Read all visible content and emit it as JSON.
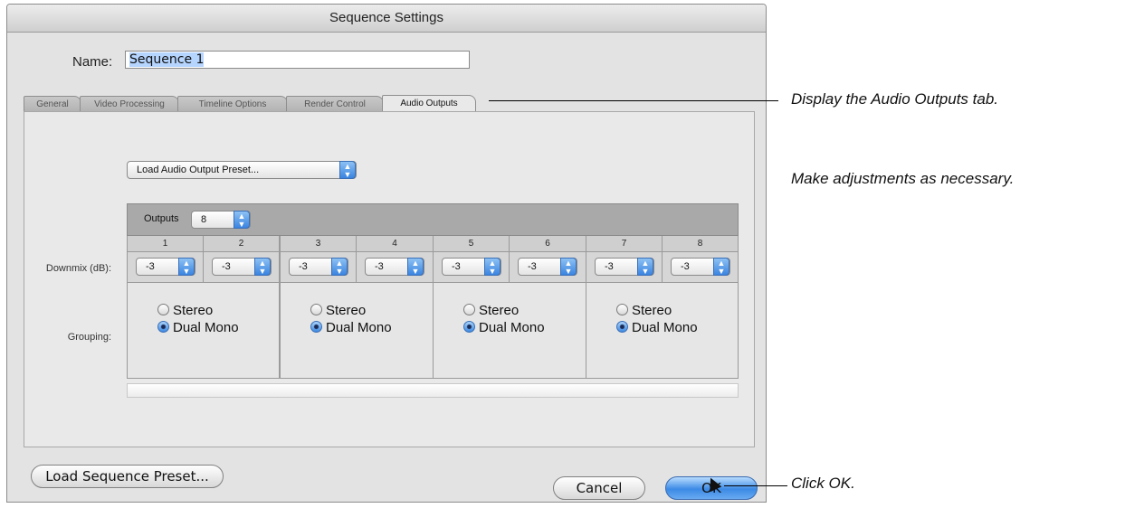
{
  "dialog": {
    "title": "Sequence Settings",
    "name_label": "Name:",
    "name_value": "Sequence 1"
  },
  "tabs": [
    {
      "label": "General"
    },
    {
      "label": "Video Processing"
    },
    {
      "label": "Timeline Options"
    },
    {
      "label": "Render Control"
    },
    {
      "label": "Audio Outputs",
      "active": true
    }
  ],
  "audio_outputs": {
    "preset_popup": "Load Audio Output Preset...",
    "outputs_label": "Outputs",
    "outputs_value": "8",
    "channels": [
      "1",
      "2",
      "3",
      "4",
      "5",
      "6",
      "7",
      "8"
    ],
    "downmix_label": "Downmix (dB):",
    "downmix_values": [
      "-3",
      "-3",
      "-3",
      "-3",
      "-3",
      "-3",
      "-3",
      "-3"
    ],
    "grouping_label": "Grouping:",
    "groups": [
      {
        "stereo": "Stereo",
        "dual_mono": "Dual Mono",
        "selected": "dual_mono"
      },
      {
        "stereo": "Stereo",
        "dual_mono": "Dual Mono",
        "selected": "dual_mono"
      },
      {
        "stereo": "Stereo",
        "dual_mono": "Dual Mono",
        "selected": "dual_mono"
      },
      {
        "stereo": "Stereo",
        "dual_mono": "Dual Mono",
        "selected": "dual_mono"
      }
    ]
  },
  "buttons": {
    "load_preset": "Load Sequence Preset...",
    "cancel": "Cancel",
    "ok": "OK"
  },
  "annotations": {
    "tab": "Display the Audio Outputs tab.",
    "adjust": "Make adjustments as necessary.",
    "ok": "Click OK."
  }
}
